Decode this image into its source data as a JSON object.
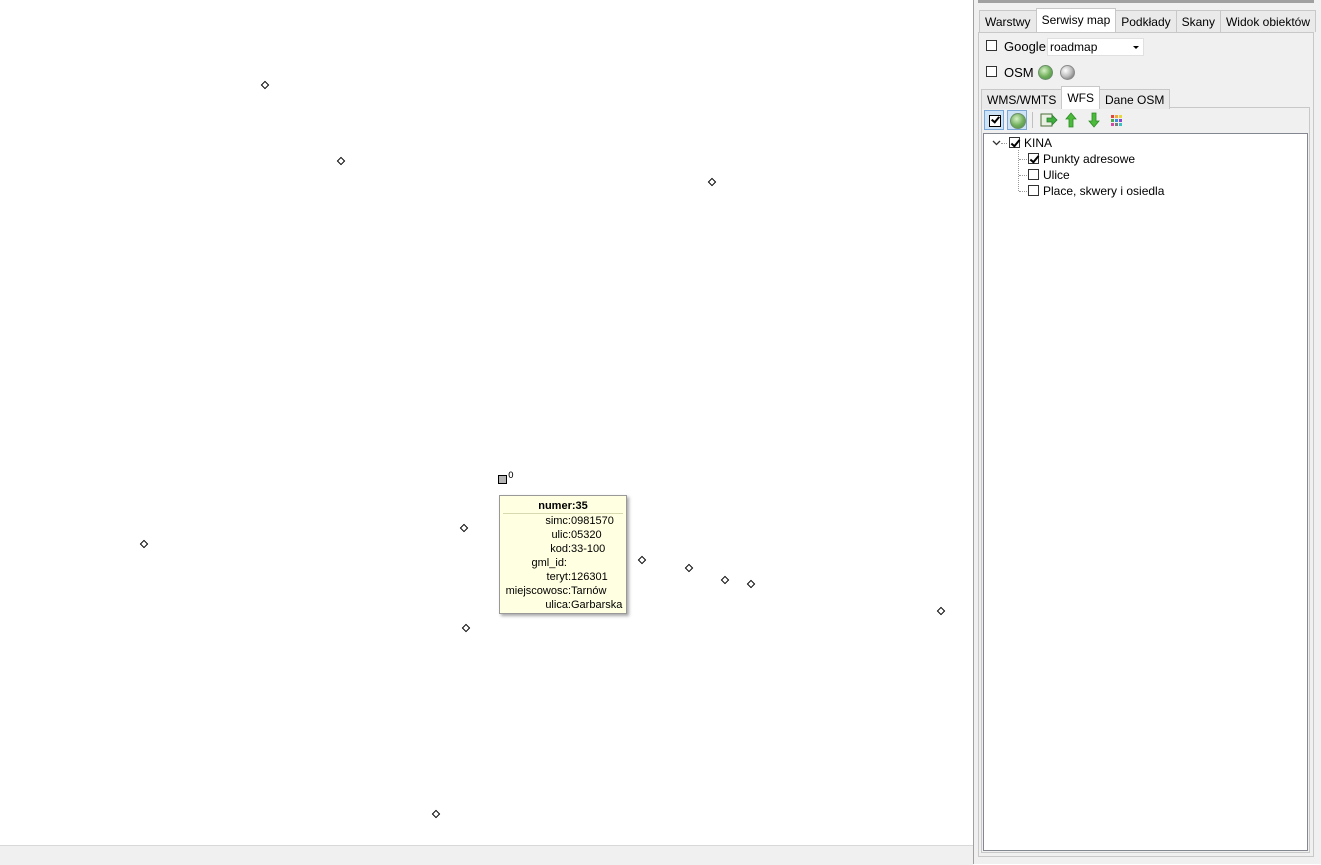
{
  "map": {
    "selected_feature_label": "0",
    "tooltip": {
      "title": "numer:35",
      "rows": [
        {
          "key": "simc:",
          "value": "0981570"
        },
        {
          "key": "ulic:",
          "value": "05320"
        },
        {
          "key": "kod:",
          "value": "33-100"
        },
        {
          "key": "gml_id:",
          "value": ""
        },
        {
          "key": "teryt:",
          "value": "126301"
        },
        {
          "key": "miejscowosc:",
          "value": "Tarnów"
        },
        {
          "key": "ulica:",
          "value": "Garbarska"
        }
      ]
    }
  },
  "panel": {
    "main_tabs": [
      "Warstwy",
      "Serwisy map",
      "Podkłady",
      "Skany",
      "Widok obiektów"
    ],
    "active_main_tab": "Serwisy map",
    "google": {
      "label": "Google",
      "checked": false,
      "map_type": "roadmap"
    },
    "osm": {
      "label": "OSM",
      "checked": false
    },
    "sub_tabs": [
      "WMS/WMTS",
      "WFS",
      "Dane OSM"
    ],
    "active_sub_tab": "WFS",
    "toolbar_icons": [
      "checkbox-toggle-icon",
      "globe-icon",
      "export-icon",
      "arrow-up-icon",
      "arrow-down-icon",
      "grid-colors-icon"
    ],
    "tree": {
      "root": {
        "label": "KINA",
        "checked": true,
        "expanded": true
      },
      "children": [
        {
          "label": "Punkty adresowe",
          "checked": true
        },
        {
          "label": "Ulice",
          "checked": false
        },
        {
          "label": "Place, skwery i osiedla",
          "checked": false
        }
      ]
    }
  },
  "colors": {
    "tooltip_bg": "#ffffe1",
    "panel_bg": "#f0f0f0",
    "pressed_btn": "#cfe3f7"
  }
}
